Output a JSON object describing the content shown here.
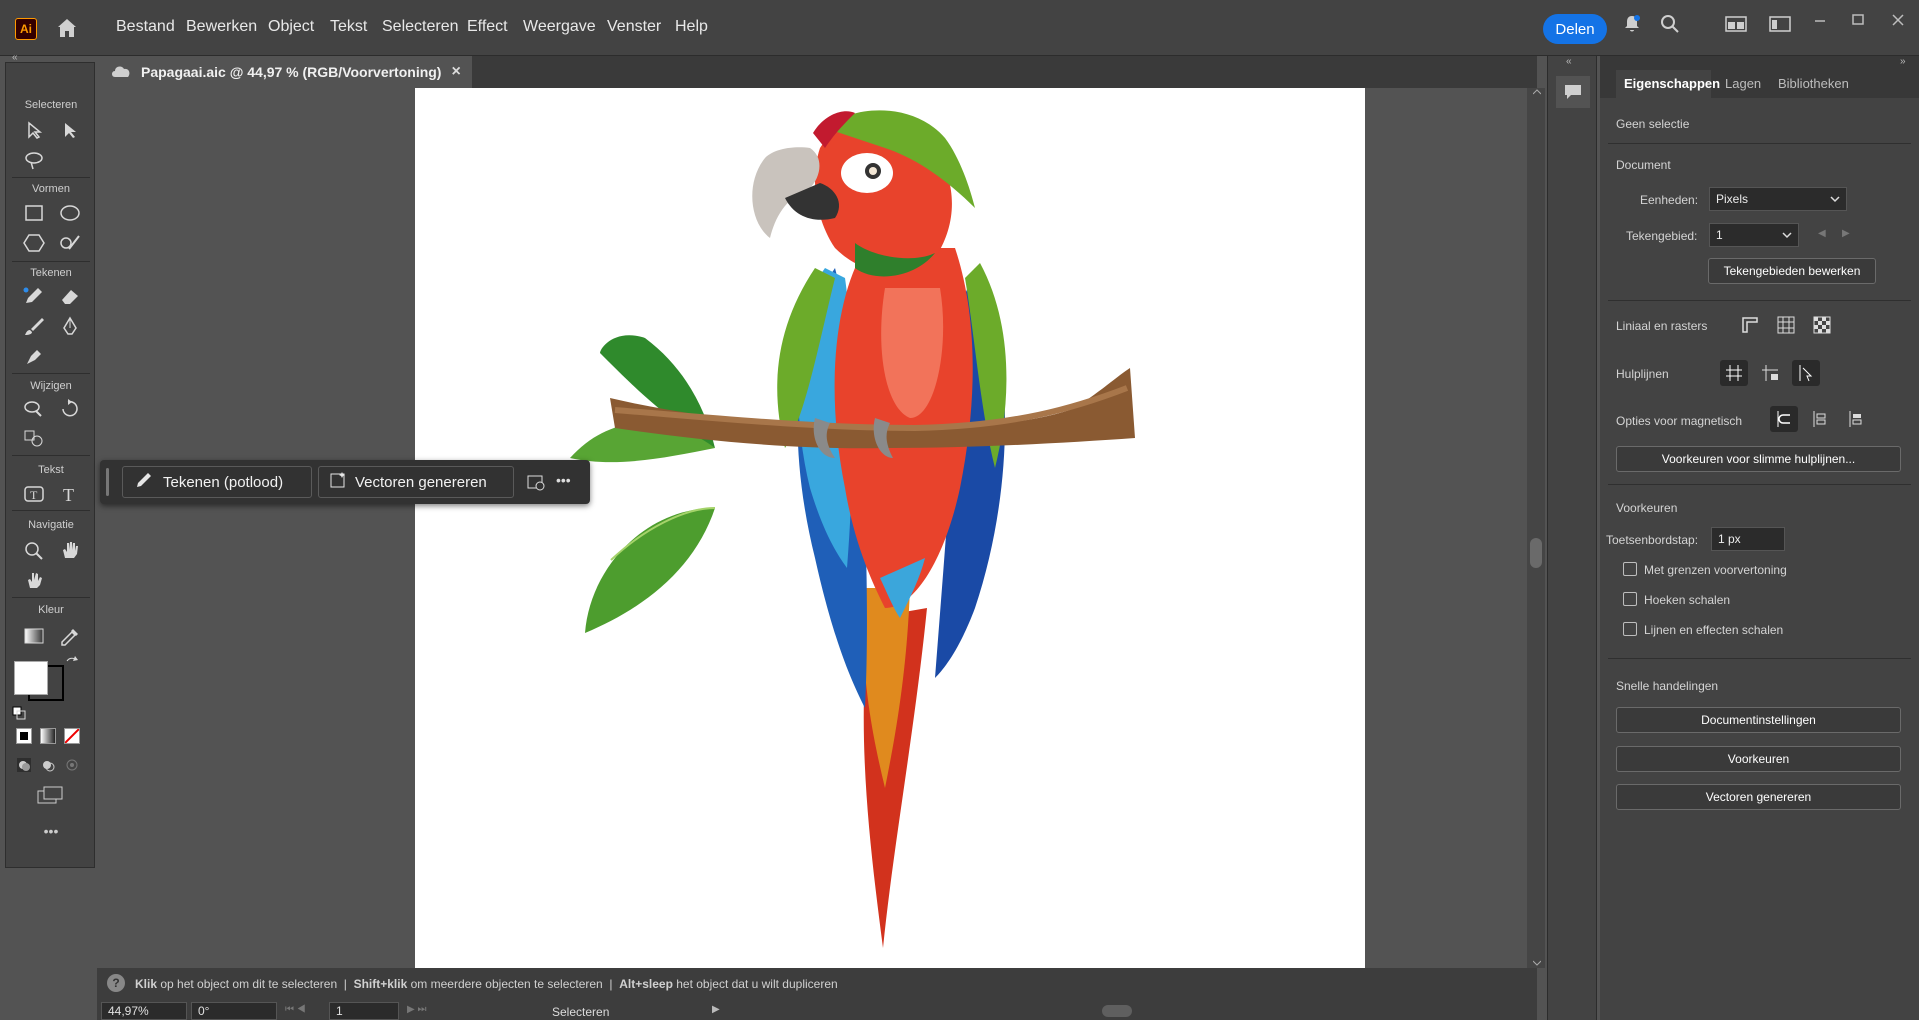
{
  "app": {
    "logo_text": "Ai"
  },
  "menu": [
    "Bestand",
    "Bewerken",
    "Object",
    "Tekst",
    "Selecteren",
    "Effect",
    "Weergave",
    "Venster",
    "Help"
  ],
  "share_button": "Delen",
  "document_tab": {
    "title": "Papagaai.aic @ 44,97 % (RGB/Voorvertoning)",
    "close": "×"
  },
  "toolbar": {
    "sections": [
      "Selecteren",
      "Vormen",
      "Tekenen",
      "Wijzigen",
      "Tekst",
      "Navigatie",
      "Kleur"
    ],
    "more": "•••"
  },
  "context_bar": {
    "draw_label": "Tekenen (potlood)",
    "generate_label": "Vectoren genereren",
    "more": "•••"
  },
  "status": {
    "hint_bold_1": "Klik",
    "hint_1": " op het object om dit te selecteren",
    "hint_bold_2": "Shift+klik",
    "hint_2": " om meerdere objecten te selecteren",
    "hint_bold_3": "Alt+sleep",
    "hint_3": " het object dat u wilt dupliceren",
    "separator": "|",
    "zoom": "44,97%",
    "rotation": "0°",
    "artboard_number": "1",
    "mode": "Selecteren"
  },
  "properties": {
    "tabs": [
      "Eigenschappen",
      "Lagen",
      "Bibliotheken"
    ],
    "no_selection": "Geen selectie",
    "document_heading": "Document",
    "units_label": "Eenheden:",
    "units_value": "Pixels",
    "artboard_label": "Tekengebied:",
    "artboard_value": "1",
    "edit_artboards": "Tekengebieden bewerken",
    "rulers_label": "Liniaal en rasters",
    "guides_label": "Hulplijnen",
    "snap_label": "Opties voor magnetisch",
    "smart_guides_button": "Voorkeuren voor slimme hulplijnen...",
    "preferences_heading": "Voorkeuren",
    "keyboard_step_label": "Toetsenbordstap:",
    "keyboard_step_value": "1 px",
    "checkboxes": [
      "Met grenzen voorvertoning",
      "Hoeken schalen",
      "Lijnen en effecten schalen"
    ],
    "quick_actions_heading": "Snelle handelingen",
    "quick_actions": [
      "Documentinstellingen",
      "Voorkeuren",
      "Vectoren genereren"
    ]
  },
  "colors": {
    "accent": "#1473e6",
    "chrome": "#434343",
    "canvas": "#535353"
  }
}
